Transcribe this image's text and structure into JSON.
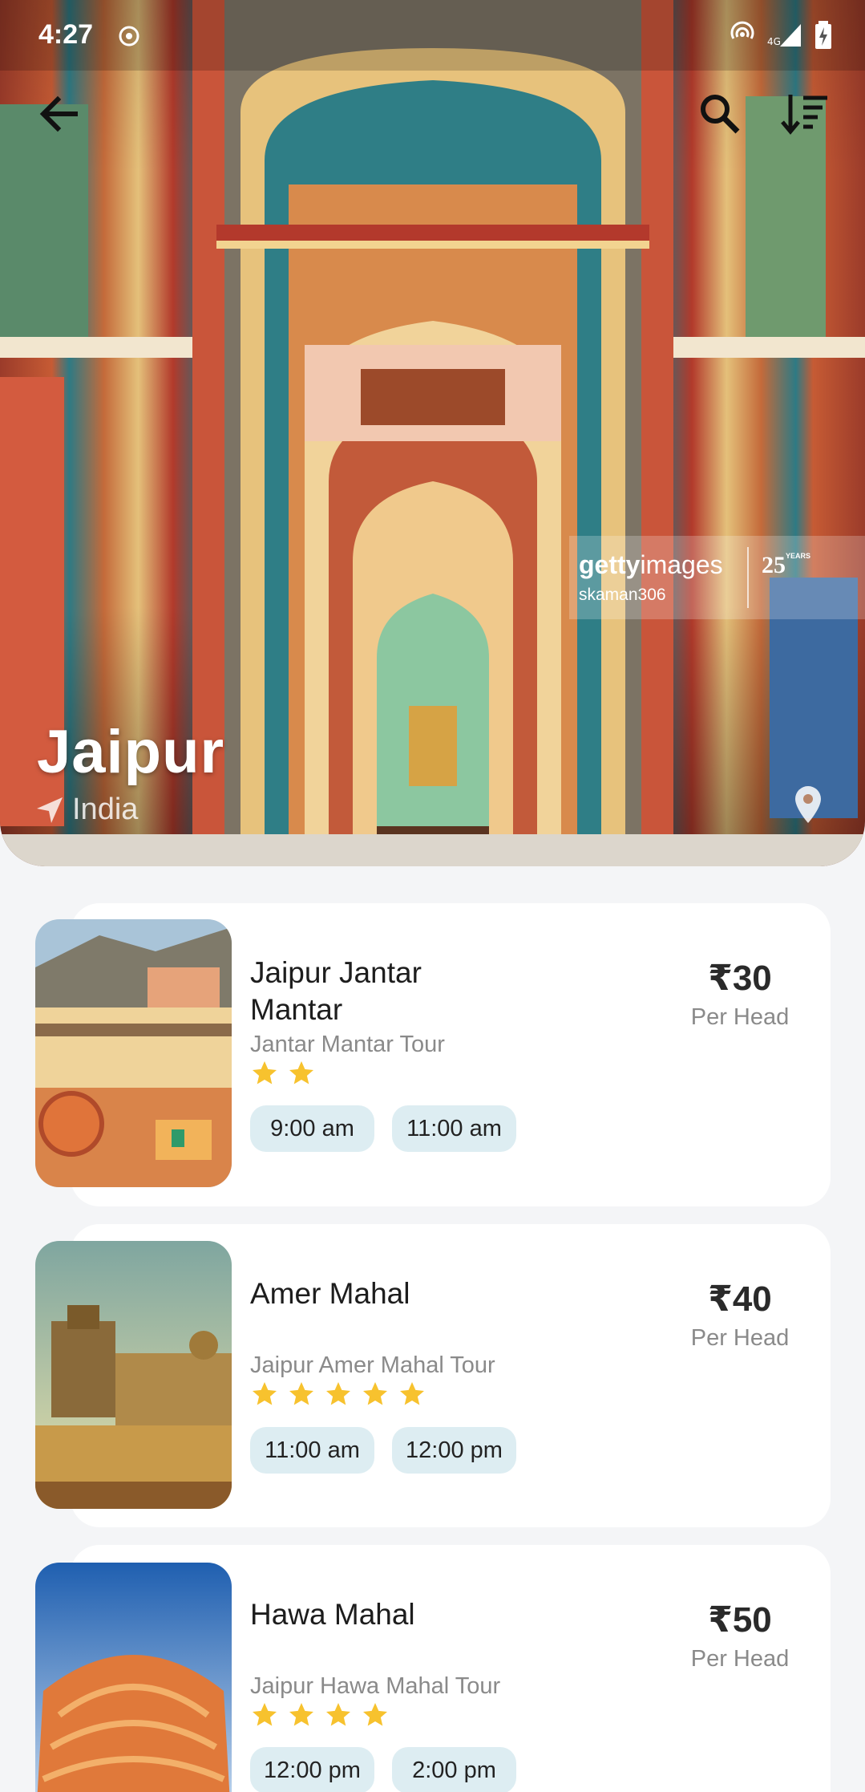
{
  "status_bar": {
    "time": "4:27"
  },
  "hero": {
    "city": "Jaipur",
    "country": "India",
    "watermark": {
      "brand_bold": "getty",
      "brand_rest": "images",
      "user": "skaman306",
      "years_number": "25",
      "years_label": "YEARS"
    }
  },
  "icons": {
    "back": "arrow-back-icon",
    "search": "search-icon",
    "sort": "sort-icon",
    "location": "navigation-arrow-icon",
    "map_pin": "map-pin-icon",
    "star": "star-icon"
  },
  "colors": {
    "star": "#F7C22E",
    "chip_bg": "#DDEDF2",
    "card_bg": "#FFFFFF",
    "page_bg": "#F4F5F7"
  },
  "tours": [
    {
      "title": "Jaipur Jantar Mantar",
      "subtitle": "Jantar Mantar Tour",
      "rating": 2,
      "price": "₹30",
      "price_unit": "Per Head",
      "times": [
        "9:00 am",
        "11:00 am"
      ]
    },
    {
      "title": "Amer Mahal",
      "subtitle": "Jaipur Amer Mahal Tour",
      "rating": 5,
      "price": "₹40",
      "price_unit": "Per Head",
      "times": [
        "11:00 am",
        "12:00 pm"
      ]
    },
    {
      "title": "Hawa Mahal",
      "subtitle": "Jaipur Hawa Mahal Tour",
      "rating": 4,
      "price": "₹50",
      "price_unit": "Per Head",
      "times": [
        "12:00 pm",
        "2:00 pm"
      ]
    }
  ]
}
